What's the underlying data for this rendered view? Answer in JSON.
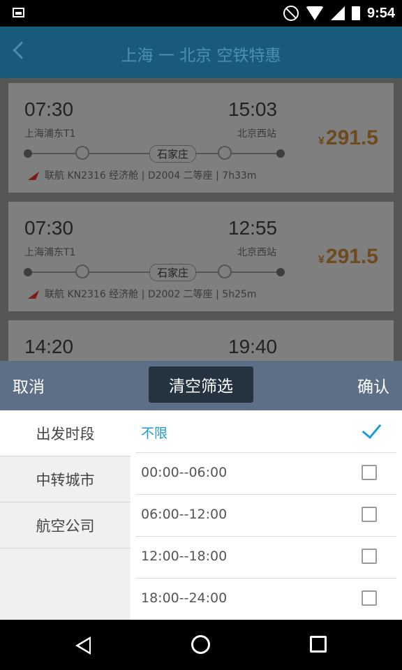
{
  "status_bar": {
    "time": "9:54"
  },
  "header": {
    "title": "上海 一 北京 空铁特惠"
  },
  "cards": [
    {
      "depart_time": "07:30",
      "arrive_time": "15:03",
      "depart_station": "上海浦东T1",
      "arrive_station": "北京西站",
      "transfer": "石家庄",
      "flight": "联航 KN2316 经济舱",
      "train": "D2004 二等座",
      "duration": "7h33m",
      "currency": "¥",
      "price": "291.5"
    },
    {
      "depart_time": "07:30",
      "arrive_time": "12:55",
      "depart_station": "上海浦东T1",
      "arrive_station": "北京西站",
      "transfer": "石家庄",
      "flight": "联航 KN2316 经济舱",
      "train": "D2002 二等座",
      "duration": "5h25m",
      "currency": "¥",
      "price": "291.5"
    },
    {
      "depart_time": "14:20",
      "arrive_time": "19:40"
    }
  ],
  "filter_bar": {
    "cancel": "取消",
    "clear": "清空筛选",
    "confirm": "确认"
  },
  "filter_categories": [
    "出发时段",
    "中转城市",
    "航空公司"
  ],
  "time_options": [
    {
      "label": "不限",
      "selected": true
    },
    {
      "label": "00:00--06:00",
      "selected": false
    },
    {
      "label": "06:00--12:00",
      "selected": false
    },
    {
      "label": "12:00--18:00",
      "selected": false
    },
    {
      "label": "18:00--24:00",
      "selected": false
    }
  ],
  "colors": {
    "accent": "#1e9bd1",
    "header": "#195a7b",
    "sheet_bar": "#5d6f87",
    "clear_button": "#253341"
  }
}
